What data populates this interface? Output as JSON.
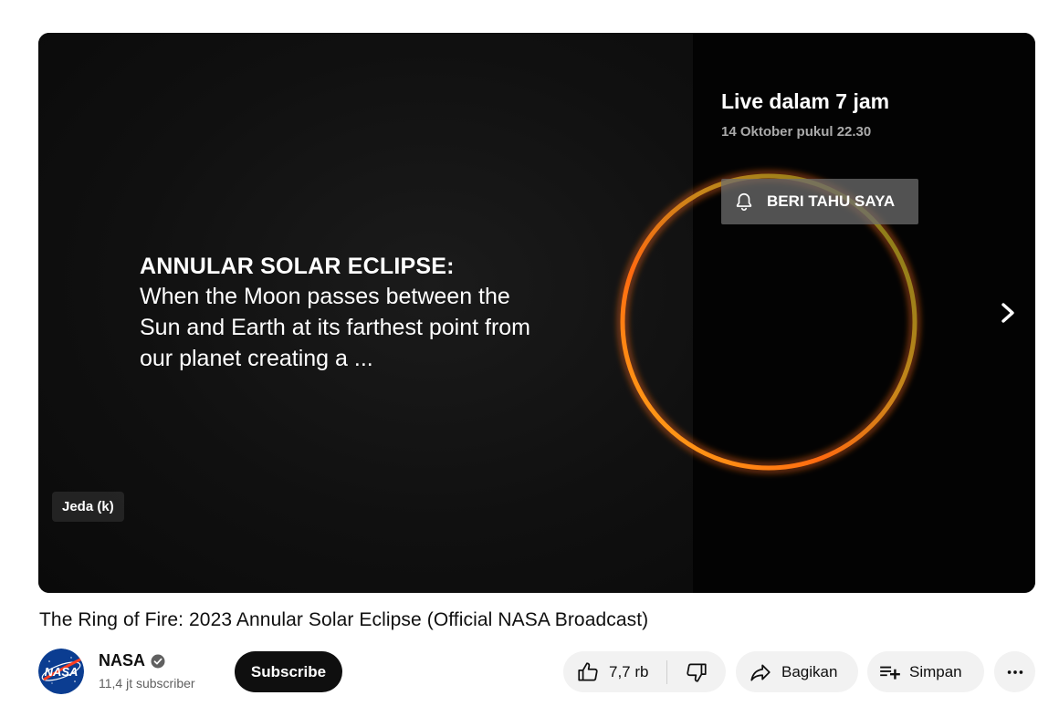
{
  "player": {
    "overlay_heading": "ANNULAR SOLAR ECLIPSE:",
    "overlay_body_lines": [
      "When the Moon passes between the",
      "Sun and Earth at its farthest point from",
      "our planet creating a ..."
    ],
    "pause_tooltip": "Jeda (k)",
    "live_status": "Live dalam 7 jam",
    "live_date": "14 Oktober pukul 22.30",
    "notify_label": "BERI TAHU SAYA",
    "icons": {
      "notify": "bell-icon",
      "next": "chevron-right-icon"
    }
  },
  "video": {
    "title": "The Ring of Fire: 2023 Annular Solar Eclipse (Official NASA Broadcast)"
  },
  "channel": {
    "name": "NASA",
    "subscribers": "11,4 jt subscriber",
    "avatar_text": "NASA",
    "verified_icon": "verified-check-icon"
  },
  "actions": {
    "subscribe_label": "Subscribe",
    "like_count": "7,7 rb",
    "share_label": "Bagikan",
    "save_label": "Simpan",
    "icons": {
      "like": "thumbs-up-icon",
      "dislike": "thumbs-down-icon",
      "share": "share-arrow-icon",
      "save": "playlist-add-icon",
      "more": "more-horizontal-icon"
    }
  },
  "colors": {
    "subscribe_bg": "#0f0f0f",
    "pill_bg": "#f2f2f2",
    "secondary_text": "#606060",
    "nasa_blue": "#0b3d91",
    "nasa_red": "#fc3d21",
    "eclipse_orange": "#ff7a1a"
  }
}
